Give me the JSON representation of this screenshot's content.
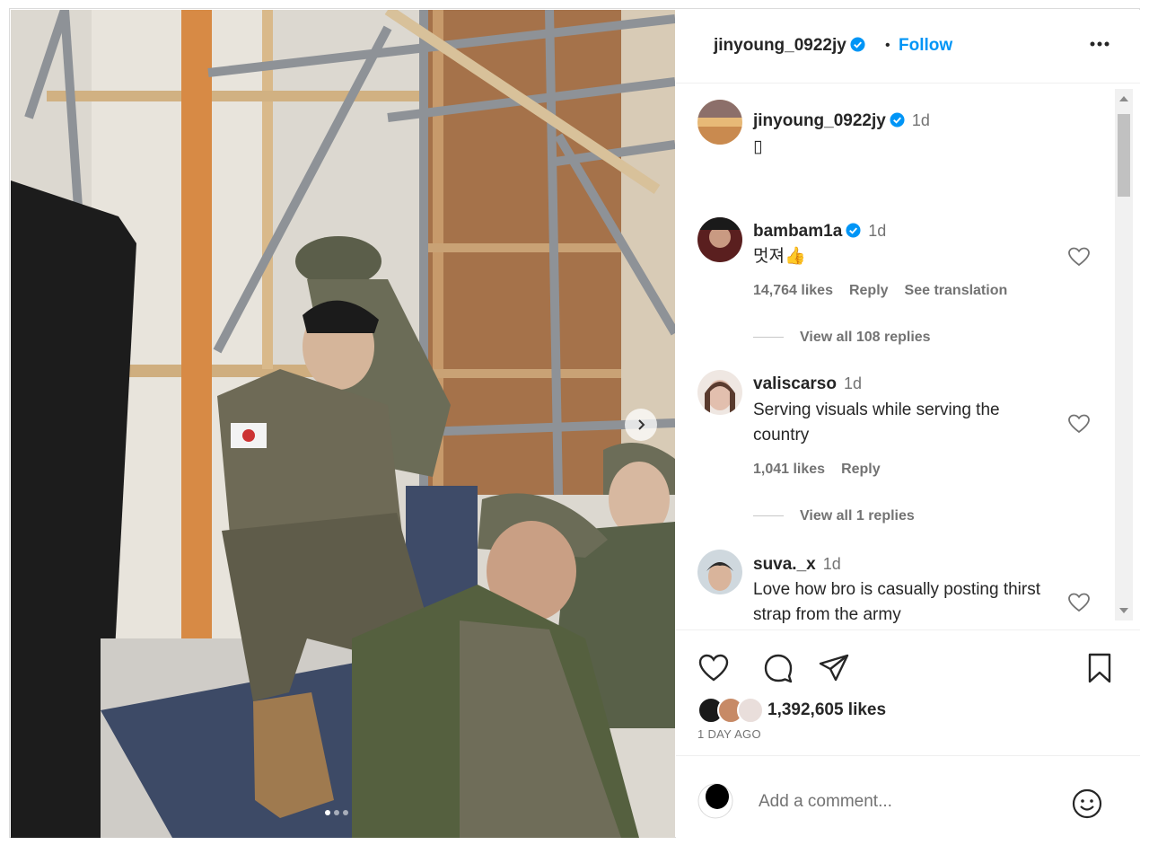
{
  "post": {
    "author": "jinyoung_0922jy",
    "verified": true,
    "separator": "•",
    "follow_label": "Follow",
    "more_icon": "more-horizontal-icon"
  },
  "caption": {
    "username": "jinyoung_0922jy",
    "time": "1d",
    "text": "▯"
  },
  "comments": [
    {
      "username": "bambam1a",
      "verified": true,
      "time": "1d",
      "text": "멋져👍",
      "likes": "14,764 likes",
      "reply_label": "Reply",
      "translate_label": "See translation",
      "view_replies": "View all 108 replies"
    },
    {
      "username": "valiscarso",
      "verified": false,
      "time": "1d",
      "text": "Serving visuals while serving the country",
      "likes": "1,041 likes",
      "reply_label": "Reply",
      "view_replies": "View all 1 replies"
    },
    {
      "username": "suva._x",
      "verified": false,
      "time": "1d",
      "text": "Love how bro is casually posting thirst strap from the army"
    }
  ],
  "actions": {
    "like_icon": "heart-icon",
    "comment_icon": "comment-icon",
    "share_icon": "send-icon",
    "save_icon": "bookmark-icon"
  },
  "likes_total": "1,392,605 likes",
  "posted_ago": "1 DAY AGO",
  "add_comment": {
    "placeholder": "Add a comment...",
    "emoji_icon": "emoji-icon"
  },
  "carousel": {
    "total": 3,
    "active_index": 0,
    "next_icon": "chevron-right-icon"
  },
  "colors": {
    "accent": "#0095f6",
    "verified": "#0095f6",
    "text": "#262626",
    "secondary": "#737373"
  }
}
